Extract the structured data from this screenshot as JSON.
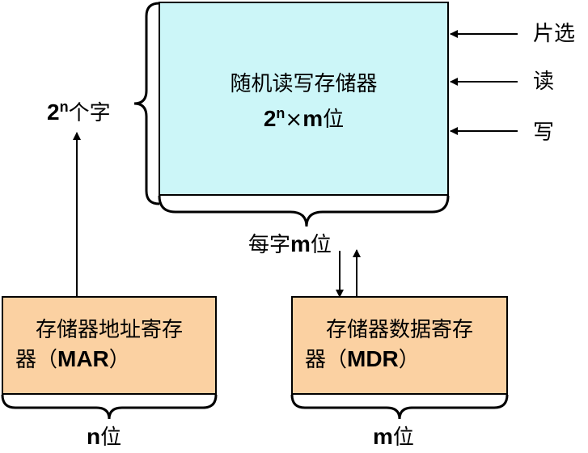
{
  "colors": {
    "ram_fill": "#ccf6f8",
    "register_fill": "#fbd1a2",
    "stroke": "#000000"
  },
  "ram": {
    "line1": "随机读写存储器",
    "size_base": "2",
    "size_exp": "n",
    "size_times": "×",
    "size_m": "m",
    "size_unit": "位"
  },
  "control_signals": [
    "片选",
    "读",
    "写"
  ],
  "word_count": {
    "base": "2",
    "exp": "n",
    "suffix": "个字"
  },
  "word_width": {
    "prefix": "每字",
    "m": "m",
    "suffix": "位"
  },
  "mar": {
    "line1": "存储器地址寄存",
    "line2_prefix": "器（",
    "line2_bold": "MAR",
    "line2_suffix": "）"
  },
  "mdr": {
    "line1": "存储器数据寄存",
    "line2_prefix": "器（",
    "line2_bold": "MDR",
    "line2_suffix": "）"
  },
  "mar_width": {
    "n": "n",
    "suffix": "位"
  },
  "mdr_width": {
    "m": "m",
    "suffix": "位"
  }
}
